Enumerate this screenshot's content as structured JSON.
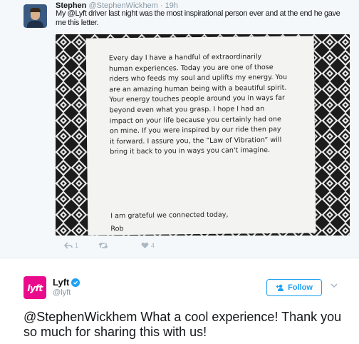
{
  "tweet": {
    "author_name": "Stephen",
    "author_handle": "@StephenWickhem",
    "dot": "·",
    "time": "19h",
    "text": "My @Lyft driver last night was the most inspirational person ever and at the end he gave me this letter.",
    "letter": {
      "body": "Every day I have a handful of extraordinarily human experiences. Today you are one of those riders who feeds my soul and uplifts my energy. You are an amazing human being with a beautiful spirit. Your energy touches people around you in ways far beyond even what you grasp. I hope I had an impact on your life because you certainly had one on mine. If you were inspired by our ride then pay it forward. I assure you, the “Law of Vibration” will bring it back to you in ways you can't imagine.",
      "closing": "I am grateful we connected today,",
      "signature": "Rob"
    },
    "actions": {
      "reply_count": "1",
      "retweet_count": "",
      "like_count": "4"
    },
    "icons": [
      "reply-icon",
      "retweet-icon",
      "heart-icon"
    ]
  },
  "reply": {
    "avatar_text": "lyft",
    "author_name": "Lyft",
    "author_handle": "@lyft",
    "follow_label": "Follow",
    "text": "@StephenWickhem What a cool experience! Thank you so much for sharing this with us!",
    "icons": [
      "verified-icon",
      "follow-person-icon",
      "chevron-down-icon"
    ]
  },
  "colors": {
    "brand_blue": "#1da1f2",
    "lyft_pink": "#ea0b8c",
    "muted": "#8899a6",
    "text": "#14171a",
    "timeline_bg": "#f5f8fa"
  }
}
